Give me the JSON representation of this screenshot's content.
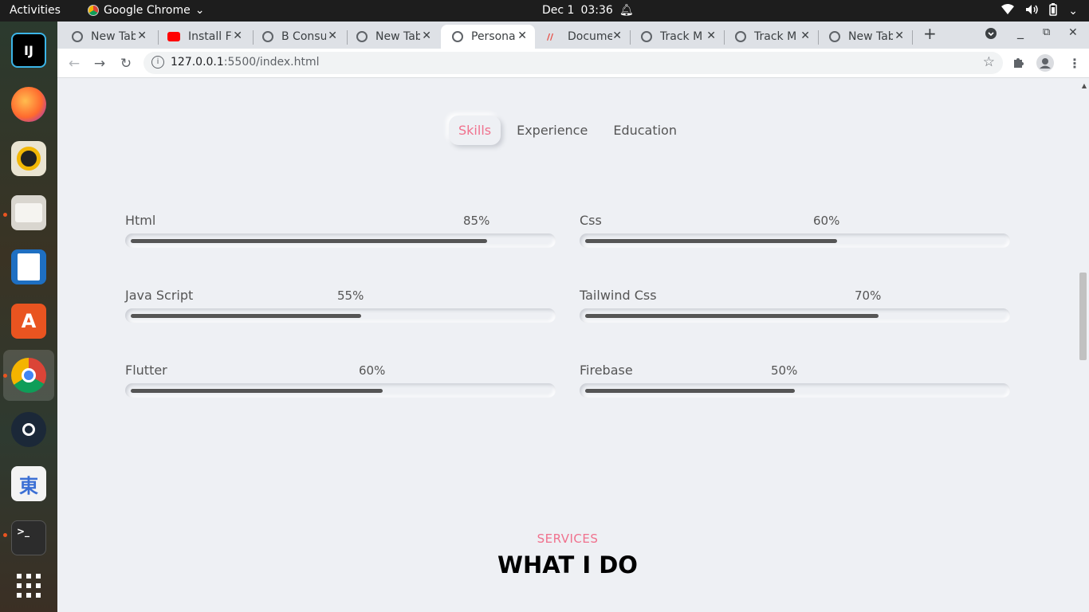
{
  "topbar": {
    "activities": "Activities",
    "app_name": "Google Chrome",
    "date": "Dec 1",
    "time": "03:36"
  },
  "browser": {
    "tabs": [
      {
        "title": "New Tab",
        "icon": "chrome-icon"
      },
      {
        "title": "Install Fl",
        "icon": "youtube-icon"
      },
      {
        "title": "B Consu",
        "icon": "globe-icon"
      },
      {
        "title": "New Tab",
        "icon": "chrome-icon"
      },
      {
        "title": "Persona",
        "icon": "globe-icon",
        "active": true
      },
      {
        "title": "Docume",
        "icon": "docs-icon"
      },
      {
        "title": "Track M",
        "icon": "globe-icon"
      },
      {
        "title": "Track M",
        "icon": "globe-icon"
      },
      {
        "title": "New Tab",
        "icon": "chrome-icon"
      }
    ],
    "url_host": "127.0.0.1",
    "url_path": ":5500/index.html"
  },
  "qualification_tabs": {
    "skills": "Skills",
    "experience": "Experience",
    "education": "Education"
  },
  "skills": [
    {
      "name": "Html",
      "percent_label": "85%",
      "percent": 85
    },
    {
      "name": "Css",
      "percent_label": "60%",
      "percent": 60
    },
    {
      "name": "Java Script",
      "percent_label": "55%",
      "percent": 55
    },
    {
      "name": "Tailwind Css",
      "percent_label": "70%",
      "percent": 70
    },
    {
      "name": "Flutter",
      "percent_label": "60%",
      "percent": 60
    },
    {
      "name": "Firebase",
      "percent_label": "50%",
      "percent": 50
    }
  ],
  "services": {
    "label": "SERVICES",
    "title": "WHAT I DO"
  },
  "colors": {
    "accent": "#f0718d",
    "background": "#eef0f4",
    "bar_fill": "#555555"
  }
}
